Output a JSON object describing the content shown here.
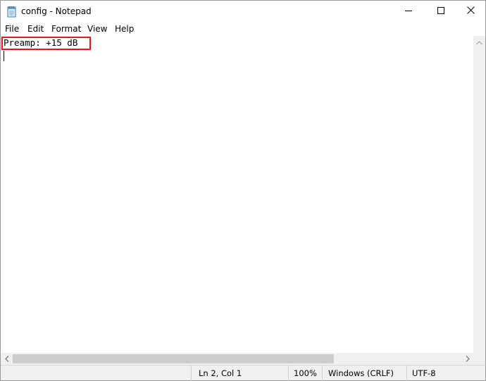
{
  "window": {
    "title": "config - Notepad",
    "controls": {
      "minimize_icon": "minimize-icon",
      "maximize_icon": "maximize-icon",
      "close_icon": "close-icon"
    }
  },
  "menu": {
    "file": "File",
    "edit": "Edit",
    "format": "Format",
    "view": "View",
    "help": "Help"
  },
  "editor": {
    "lines": [
      "Preamp: +15 dB",
      ""
    ],
    "highlight_color": "#e8141b"
  },
  "status": {
    "position": "Ln 2, Col 1",
    "zoom": "100%",
    "line_ending": "Windows (CRLF)",
    "encoding": "UTF-8"
  }
}
